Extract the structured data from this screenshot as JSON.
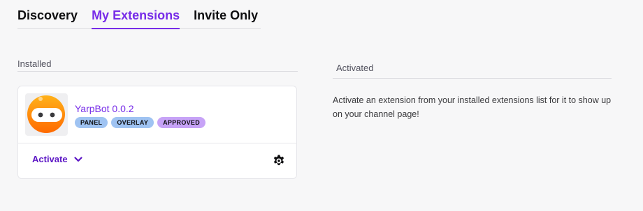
{
  "tabs": [
    {
      "label": "Discovery",
      "active": false
    },
    {
      "label": "My Extensions",
      "active": true
    },
    {
      "label": "Invite Only",
      "active": false
    }
  ],
  "installed": {
    "title": "Installed",
    "extension": {
      "name": "YarpBot 0.0.2",
      "logo_icon": "yarpbot-robot-logo",
      "badges": [
        {
          "label": "PANEL",
          "color": "#9fc3f2"
        },
        {
          "label": "OVERLAY",
          "color": "#9fc3f2"
        },
        {
          "label": "APPROVED",
          "color": "#c7a3f7"
        }
      ],
      "activate_label": "Activate",
      "settings_icon": "gear-icon"
    }
  },
  "activated": {
    "title": "Activated",
    "description": "Activate an extension from your installed extensions list for it to show up on your channel page!"
  },
  "colors": {
    "accent": "#772ce8",
    "background": "#f7f7f8"
  }
}
